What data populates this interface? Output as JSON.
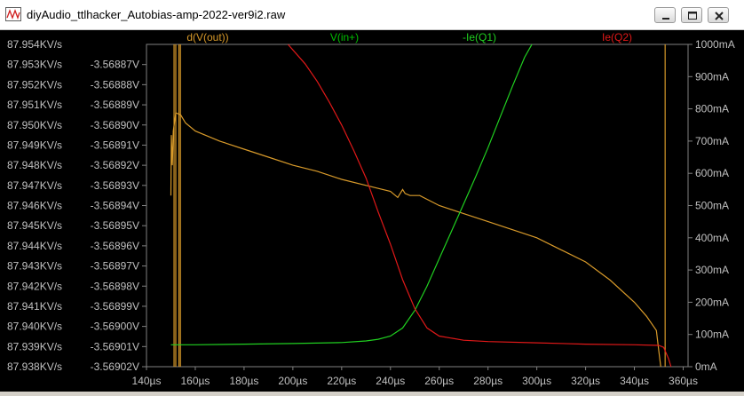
{
  "window": {
    "title": "diyAudio_ttlhacker_Autobias-amp-2022-ver9i2.raw",
    "buttons": [
      "minimize",
      "maximize",
      "close"
    ]
  },
  "colors": {
    "background": "#000000",
    "axis_text": "#c0c0c0",
    "trace_dVout": "#d89a2a",
    "trace_Vin": "#00c000",
    "trace_IeQ1": "#20d020",
    "trace_IeQ2": "#e01818"
  },
  "chart_data": {
    "type": "line",
    "x_label_unit": "µs",
    "x_ticks": [
      "140µs",
      "160µs",
      "180µs",
      "200µs",
      "220µs",
      "240µs",
      "260µs",
      "280µs",
      "300µs",
      "320µs",
      "340µs",
      "360µs"
    ],
    "xlim": [
      140,
      362
    ],
    "left_axis_1": {
      "ticks": [
        "87.954KV/s",
        "87.953KV/s",
        "87.952KV/s",
        "87.951KV/s",
        "87.950KV/s",
        "87.949KV/s",
        "87.948KV/s",
        "87.947KV/s",
        "87.946KV/s",
        "87.945KV/s",
        "87.944KV/s",
        "87.943KV/s",
        "87.942KV/s",
        "87.941KV/s",
        "87.940KV/s",
        "87.939KV/s",
        "87.938KV/s"
      ],
      "range": [
        87.938,
        87.954
      ]
    },
    "left_axis_2": {
      "ticks": [
        "-3.56887V",
        "-3.56888V",
        "-3.56889V",
        "-3.56890V",
        "-3.56891V",
        "-3.56892V",
        "-3.56893V",
        "-3.56894V",
        "-3.56895V",
        "-3.56896V",
        "-3.56897V",
        "-3.56898V",
        "-3.56899V",
        "-3.56900V",
        "-3.56901V",
        "-3.56902V"
      ],
      "range": [
        -3.56902,
        -3.56886
      ]
    },
    "right_axis": {
      "ticks": [
        "1000mA",
        "900mA",
        "800mA",
        "700mA",
        "600mA",
        "500mA",
        "400mA",
        "300mA",
        "200mA",
        "100mA",
        "0mA"
      ],
      "range": [
        0,
        1000
      ]
    },
    "series": [
      {
        "name": "d(V(out))",
        "color": "#d89a2a",
        "axis": "left_axis_1",
        "points": [
          [
            150,
            87.9465
          ],
          [
            150.2,
            87.9495
          ],
          [
            150.6,
            87.948
          ],
          [
            151,
            87.9497
          ],
          [
            152,
            87.9506
          ],
          [
            154,
            87.9505
          ],
          [
            156,
            87.9501
          ],
          [
            160,
            87.9497
          ],
          [
            170,
            87.9492
          ],
          [
            180,
            87.9488
          ],
          [
            190,
            87.9484
          ],
          [
            200,
            87.948
          ],
          [
            210,
            87.9477
          ],
          [
            220,
            87.9473
          ],
          [
            230,
            87.947
          ],
          [
            240,
            87.9467
          ],
          [
            243,
            87.9464
          ],
          [
            245,
            87.9468
          ],
          [
            246,
            87.9466
          ],
          [
            248,
            87.9465
          ],
          [
            252,
            87.9465
          ],
          [
            260,
            87.946
          ],
          [
            270,
            87.9456
          ],
          [
            280,
            87.9452
          ],
          [
            290,
            87.9448
          ],
          [
            300,
            87.9444
          ],
          [
            310,
            87.9438
          ],
          [
            320,
            87.9432
          ],
          [
            330,
            87.9423
          ],
          [
            340,
            87.9412
          ],
          [
            345,
            87.9405
          ],
          [
            349,
            87.9398
          ],
          [
            350,
            87.9388
          ],
          [
            351,
            87.9378
          ],
          [
            352,
            87.937
          ],
          [
            355,
            87.938
          ]
        ]
      },
      {
        "name": "V(in+)",
        "color": "#00c000",
        "axis": "left_axis_2",
        "points": []
      },
      {
        "name": "-Ie(Q1)",
        "color": "#20d020",
        "axis": "right_axis",
        "points": [
          [
            150,
            68
          ],
          [
            160,
            68
          ],
          [
            180,
            70
          ],
          [
            200,
            72
          ],
          [
            220,
            75
          ],
          [
            230,
            80
          ],
          [
            235,
            85
          ],
          [
            240,
            95
          ],
          [
            245,
            120
          ],
          [
            250,
            175
          ],
          [
            255,
            250
          ],
          [
            260,
            335
          ],
          [
            265,
            420
          ],
          [
            270,
            505
          ],
          [
            275,
            590
          ],
          [
            280,
            680
          ],
          [
            285,
            775
          ],
          [
            290,
            870
          ],
          [
            295,
            960
          ],
          [
            298,
            1000
          ]
        ]
      },
      {
        "name": "Ie(Q2)",
        "color": "#e01818",
        "axis": "right_axis",
        "points": [
          [
            198,
            1000
          ],
          [
            205,
            940
          ],
          [
            210,
            885
          ],
          [
            215,
            820
          ],
          [
            220,
            750
          ],
          [
            225,
            670
          ],
          [
            230,
            585
          ],
          [
            235,
            480
          ],
          [
            240,
            380
          ],
          [
            245,
            270
          ],
          [
            250,
            180
          ],
          [
            255,
            120
          ],
          [
            260,
            95
          ],
          [
            270,
            82
          ],
          [
            280,
            78
          ],
          [
            300,
            74
          ],
          [
            320,
            70
          ],
          [
            340,
            68
          ],
          [
            350,
            66
          ],
          [
            352,
            60
          ],
          [
            354,
            25
          ],
          [
            355,
            0
          ]
        ]
      }
    ],
    "legend": [
      "d(V(out))",
      "V(in+)",
      "-Ie(Q1)",
      "Ie(Q2)"
    ],
    "cursor_lines_x": [
      151.3,
      152.0,
      153.3,
      153.9,
      352.6
    ]
  }
}
